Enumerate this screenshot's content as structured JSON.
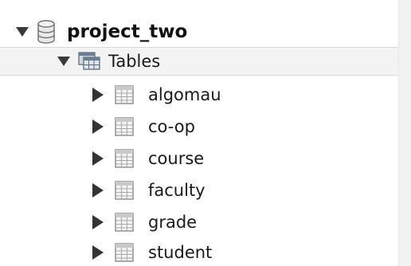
{
  "schema": {
    "name": "project_two",
    "expanded": true,
    "icon": "database-icon"
  },
  "tables_folder": {
    "label": "Tables",
    "expanded": true,
    "icon": "tables-folder-icon"
  },
  "tables": [
    {
      "name": "algomau",
      "icon": "table-grid-icon",
      "expanded": false
    },
    {
      "name": "co-op",
      "icon": "table-grid-icon",
      "expanded": false
    },
    {
      "name": "course",
      "icon": "table-grid-icon",
      "expanded": false
    },
    {
      "name": "faculty",
      "icon": "table-grid-icon",
      "expanded": false
    },
    {
      "name": "grade",
      "icon": "table-grid-icon",
      "expanded": false
    },
    {
      "name": "student",
      "icon": "table-grid-icon",
      "expanded": false
    }
  ],
  "colors": {
    "selected_row_bg": "#f3f3f3",
    "arrow": "#333333",
    "text": "#1a1a1a"
  }
}
